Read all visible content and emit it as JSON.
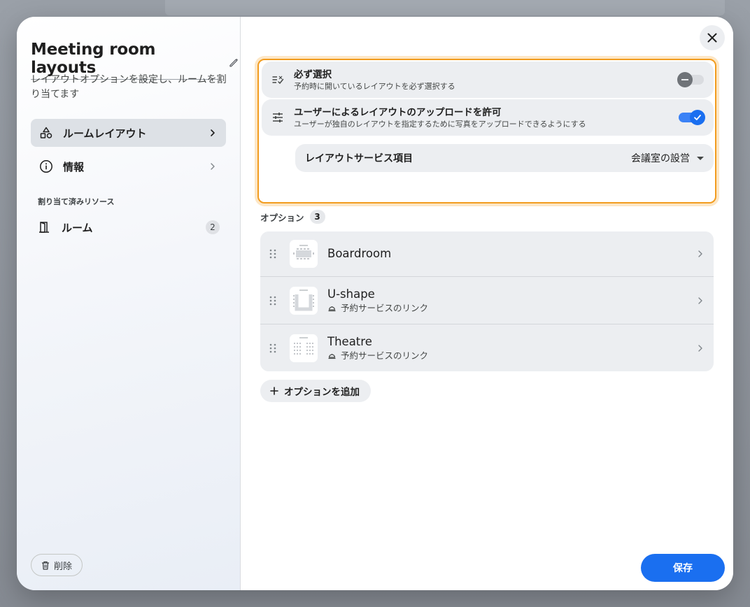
{
  "panel": {
    "title": "Meeting room layouts",
    "description": "レイアウトオプションを設定し、ルームを割り当てます",
    "nav": [
      {
        "label": "ルームレイアウト",
        "icon": "shapes-icon",
        "active": true
      },
      {
        "label": "情報",
        "icon": "info-icon",
        "active": false
      }
    ],
    "assigned_section": "割り当て済みリソース",
    "room_item": {
      "label": "ルーム",
      "count": "2",
      "icon": "door-icon"
    },
    "delete_label": "削除"
  },
  "settings": {
    "required": {
      "title": "必ず選択",
      "subtitle": "予約時に開いているレイアウトを必ず選択する",
      "enabled": false
    },
    "upload": {
      "title": "ユーザーによるレイアウトのアップロードを許可",
      "subtitle": "ユーザーが独自のレイアウトを指定するために写真をアップロードできるようにする",
      "enabled": true
    },
    "service": {
      "label": "レイアウトサービス項目",
      "value": "会議室の設営"
    }
  },
  "options": {
    "label": "オプション",
    "count": "3",
    "items": [
      {
        "name": "Boardroom",
        "link": ""
      },
      {
        "name": "U-shape",
        "link": "予約サービスのリンク"
      },
      {
        "name": "Theatre",
        "link": "予約サービスのリンク"
      }
    ],
    "add_label": "オプションを追加"
  },
  "actions": {
    "save_label": "保存"
  },
  "colors": {
    "accent": "#1a6ff0",
    "highlight_border": "#f29c1f"
  }
}
